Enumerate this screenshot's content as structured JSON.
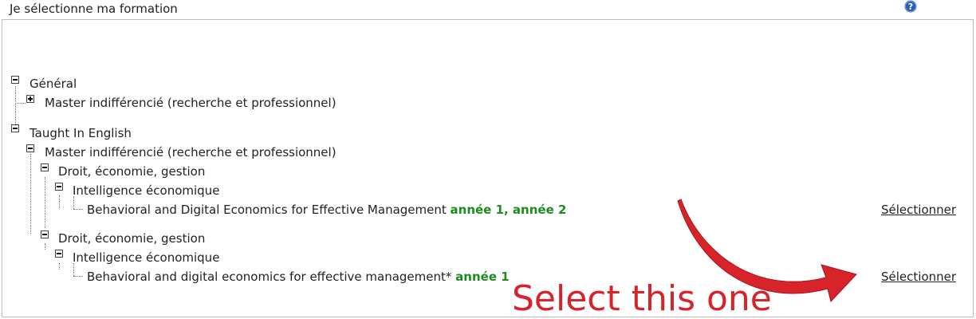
{
  "header": {
    "title": "Je sélectionne ma formation",
    "help_icon": "help-icon"
  },
  "tree": {
    "general": {
      "label": "Général",
      "master": "Master indifférencié (recherche et professionnel)"
    },
    "english": {
      "label": "Taught In English",
      "master": "Master indifférencié (recherche et professionnel)",
      "branch1": {
        "domain": "Droit, économie, gestion",
        "mention": "Intelligence économique",
        "course": "Behavioral and Digital Economics for Effective Management",
        "years": "année 1, année 2",
        "select": "Sélectionner"
      },
      "branch2": {
        "domain": "Droit, économie, gestion",
        "mention": "Intelligence économique",
        "course": "Behavioral and digital economics for effective management*",
        "years": "année 1",
        "select": "Sélectionner"
      }
    }
  },
  "annotation": {
    "text": "Select this one",
    "color": "#d9232b"
  },
  "colors": {
    "years": "#1f8a1f",
    "help": "#2a5db0"
  }
}
